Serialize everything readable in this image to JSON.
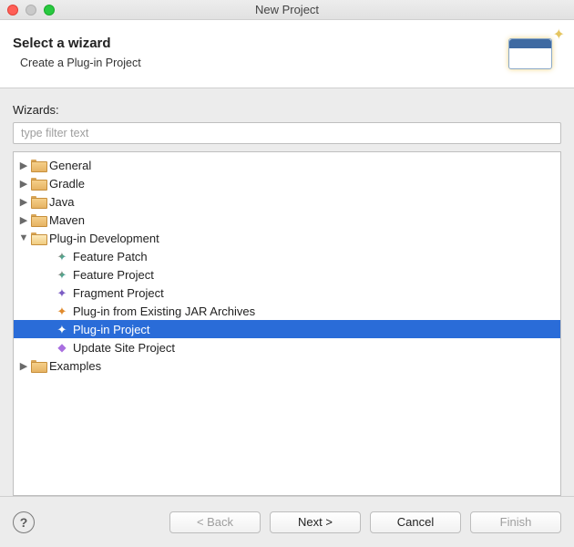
{
  "window": {
    "title": "New Project"
  },
  "banner": {
    "heading": "Select a wizard",
    "subheading": "Create a Plug-in Project"
  },
  "wizards_label": "Wizards:",
  "filter": {
    "placeholder": "type filter text",
    "value": ""
  },
  "tree": {
    "top": [
      {
        "label": "General",
        "expanded": false
      },
      {
        "label": "Gradle",
        "expanded": false
      },
      {
        "label": "Java",
        "expanded": false
      },
      {
        "label": "Maven",
        "expanded": false
      }
    ],
    "plugdev": {
      "label": "Plug-in Development",
      "expanded": true,
      "children": [
        {
          "label": "Feature Patch",
          "icon": "puzzle-multi"
        },
        {
          "label": "Feature Project",
          "icon": "puzzle-multi"
        },
        {
          "label": "Fragment Project",
          "icon": "puzzle-purple"
        },
        {
          "label": "Plug-in from Existing JAR Archives",
          "icon": "puzzle-orange"
        },
        {
          "label": "Plug-in Project",
          "icon": "puzzle-multi",
          "selected": true
        },
        {
          "label": "Update Site Project",
          "icon": "diamond-purple"
        }
      ]
    },
    "bottom": [
      {
        "label": "Examples",
        "expanded": false
      }
    ]
  },
  "buttons": {
    "back": "< Back",
    "next": "Next >",
    "cancel": "Cancel",
    "finish": "Finish",
    "help": "?"
  },
  "state": {
    "back_enabled": false,
    "next_enabled": true,
    "cancel_enabled": true,
    "finish_enabled": false
  }
}
